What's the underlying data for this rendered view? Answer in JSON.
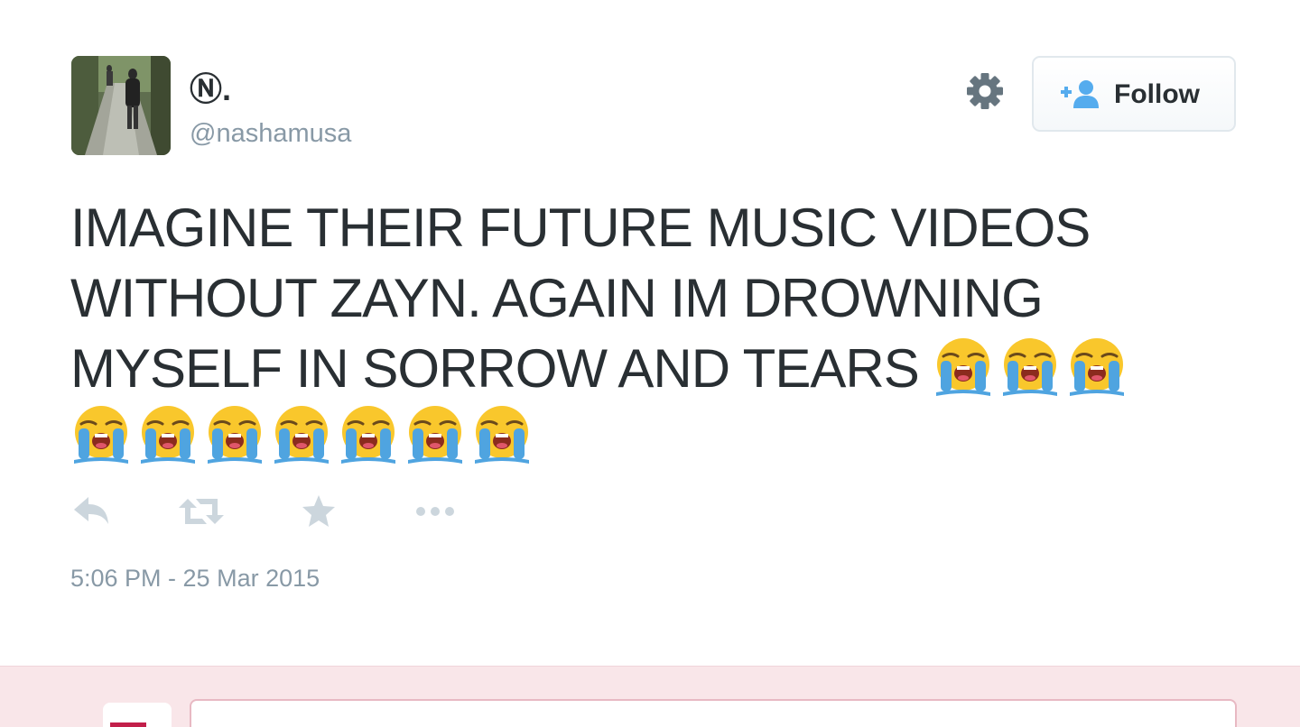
{
  "author": {
    "display_name": "Ⓝ.",
    "handle": "@nashamusa",
    "avatar": "avatar-photo"
  },
  "header": {
    "settings_icon": "gear-icon",
    "follow_button": {
      "icon": "follow-user-plus-icon",
      "label": "Follow"
    }
  },
  "tweet": {
    "lines": [
      "IMAGINE THEIR FUTURE MUSIC VIDEOS",
      "WITHOUT ZAYN. AGAIN IM DROWNING",
      "MYSELF IN SORROW AND TEARS"
    ],
    "emoji_name": "loudly-crying-face",
    "emoji_line3_count": 3,
    "emoji_line4_count": 7,
    "timestamp": "5:06 PM - 25 Mar 2015"
  },
  "actions": [
    {
      "name": "reply",
      "icon": "reply-icon"
    },
    {
      "name": "retweet",
      "icon": "retweet-icon"
    },
    {
      "name": "favorite",
      "icon": "star-icon"
    },
    {
      "name": "more",
      "icon": "more-dots-icon"
    }
  ],
  "colors": {
    "text": "#292f33",
    "muted": "#8899a6",
    "follow_accent": "#55acee",
    "action_icon": "#ccd6dd",
    "reply_area_bg": "#f9e6e9"
  }
}
